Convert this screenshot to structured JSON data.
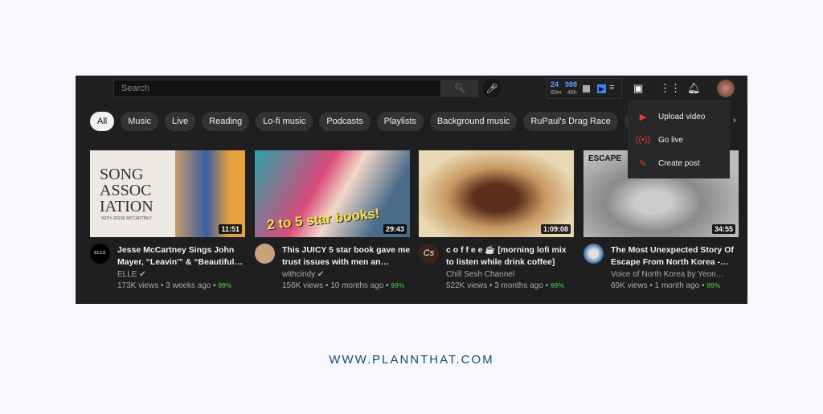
{
  "header": {
    "search_placeholder": "Search",
    "ext": {
      "a": "24",
      "a_sub": "60m",
      "b": "988",
      "b_sub": "48h"
    }
  },
  "chips": [
    "All",
    "Music",
    "Live",
    "Reading",
    "Lo-fi music",
    "Podcasts",
    "Playlists",
    "Background music",
    "RuPaul's Drag Race",
    "Med"
  ],
  "menu": {
    "items": [
      {
        "label": "Upload video",
        "icon": "upload-video-icon"
      },
      {
        "label": "Go live",
        "icon": "live-icon"
      },
      {
        "label": "Create post",
        "icon": "create-post-icon"
      }
    ]
  },
  "videos": [
    {
      "title": "Jesse McCartney Sings John Mayer, “Leavin'” & “Beautiful…",
      "channel": "ELLE",
      "verified": true,
      "views": "173K views • 3 weeks ago • ",
      "rating": "99%",
      "duration": "11:51",
      "thumb_text": "SONG ASSOC IATION",
      "thumb_sub": "WITH JESSE MCCARTNEY",
      "avatar_text": "ELLE"
    },
    {
      "title": "This JUICY 5 star book gave me trust issues with men an…",
      "channel": "withcindy",
      "verified": true,
      "views": "156K views • 10 months ago • ",
      "rating": "99%",
      "duration": "29:43",
      "thumb_text": "2 to 5 star books!"
    },
    {
      "title": "c o f f e e ☕ [morning lofi mix to listen while drink coffee]",
      "channel": "Chill Sesh Channel",
      "verified": false,
      "views": "522K views • 3 months ago • ",
      "rating": "99%",
      "duration": "1:09:08",
      "avatar_text": "Cs"
    },
    {
      "title": "The Most Unexpected Story Of Escape From North Korea -…",
      "channel": "Voice of North Korea by Yeon…",
      "verified": false,
      "views": "69K views • 1 month ago • ",
      "rating": "99%",
      "duration": "34:55",
      "thumb_text": "ESCAPE"
    }
  ],
  "footer": "WWW.PLANNTHAT.COM",
  "colors": {
    "rating": "#3ea63e",
    "footer": "#1e4a73",
    "background": "#1f1f1f"
  }
}
